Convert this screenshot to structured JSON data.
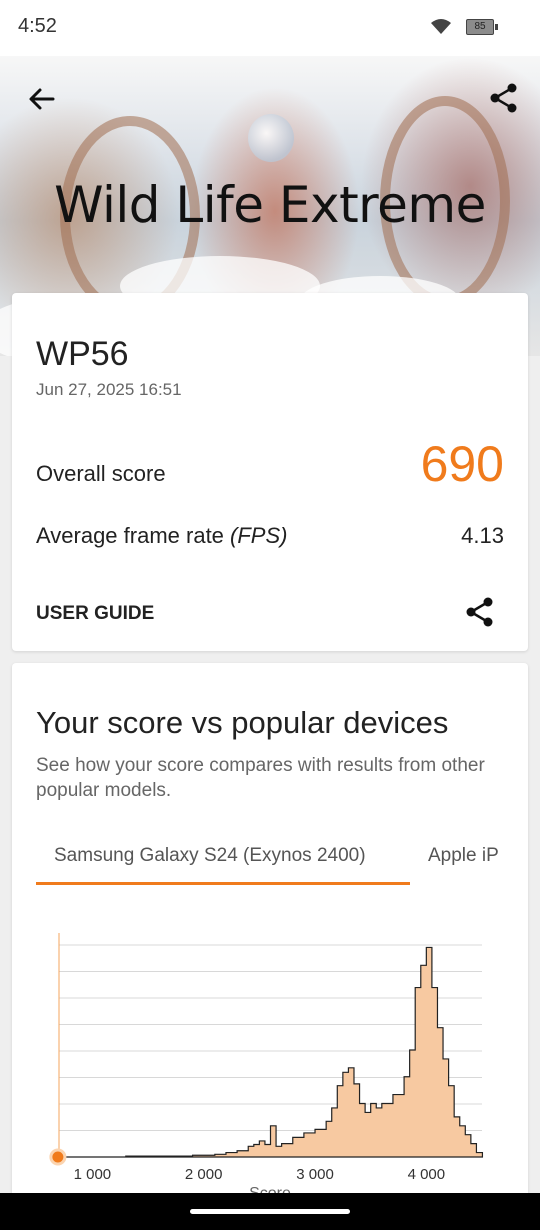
{
  "status": {
    "time": "4:52",
    "battery": "85"
  },
  "hero": {
    "title": "Wild Life Extreme"
  },
  "result": {
    "device": "WP56",
    "date": "Jun 27, 2025 16:51",
    "overall_label": "Overall score",
    "overall_value": "690",
    "fps_label_prefix": "Average frame rate ",
    "fps_label_unit": "(FPS)",
    "fps_value": "4.13",
    "user_guide": "USER GUIDE"
  },
  "compare": {
    "title": "Your score vs popular devices",
    "subtitle": "See how your score compares with results from other popular models.",
    "tabs": [
      "Samsung Galaxy S24 (Exynos 2400)",
      "Apple iP"
    ]
  },
  "colors": {
    "accent": "#f07b1c",
    "fill": "#f7c9a1"
  },
  "chart_data": {
    "type": "area",
    "xlabel": "Score",
    "xticks": [
      "1 000",
      "2 000",
      "3 000",
      "4 000"
    ],
    "xlim": [
      700,
      4500
    ],
    "your_score": 690,
    "x": [
      700,
      1000,
      1300,
      1600,
      1900,
      2100,
      2200,
      2300,
      2400,
      2450,
      2500,
      2550,
      2600,
      2650,
      2700,
      2800,
      2900,
      3000,
      3100,
      3150,
      3200,
      3250,
      3300,
      3350,
      3400,
      3450,
      3500,
      3550,
      3600,
      3700,
      3800,
      3850,
      3900,
      3950,
      4000,
      4050,
      4100,
      4150,
      4200,
      4250,
      4300,
      4350,
      4400,
      4450
    ],
    "values": [
      0,
      0,
      1,
      1,
      2,
      3,
      5,
      7,
      12,
      14,
      18,
      14,
      35,
      12,
      15,
      22,
      27,
      31,
      40,
      55,
      80,
      95,
      100,
      82,
      60,
      50,
      60,
      55,
      60,
      70,
      90,
      120,
      190,
      215,
      235,
      190,
      145,
      110,
      80,
      45,
      35,
      25,
      15,
      5
    ],
    "ylim": [
      0,
      240
    ]
  }
}
